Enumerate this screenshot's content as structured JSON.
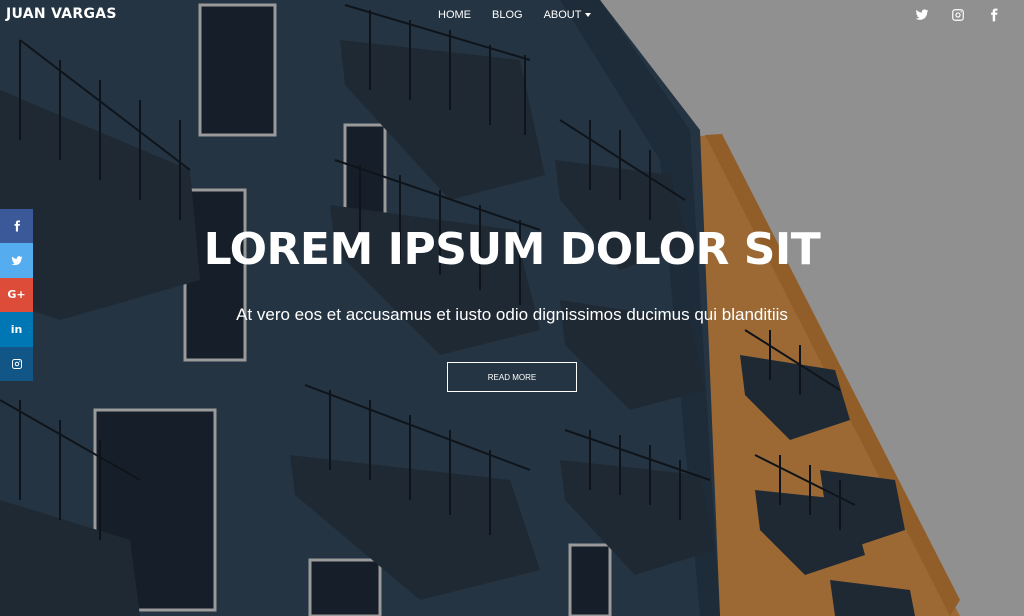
{
  "brand": {
    "name": "JUAN VARGAS"
  },
  "nav": {
    "items": [
      {
        "label": "HOME"
      },
      {
        "label": "BLOG"
      },
      {
        "label": "ABOUT"
      }
    ],
    "social": [
      {
        "icon": "twitter-icon"
      },
      {
        "icon": "instagram-icon"
      },
      {
        "icon": "facebook-icon"
      }
    ]
  },
  "share_bar": {
    "buttons": [
      {
        "icon": "facebook-icon",
        "color": "#3b5998"
      },
      {
        "icon": "twitter-icon",
        "color": "#55acee"
      },
      {
        "icon": "google-plus-icon",
        "label": "G+",
        "color": "#dd4b39"
      },
      {
        "icon": "linkedin-icon",
        "label": "in",
        "color": "#0077b5"
      },
      {
        "icon": "instagram-icon",
        "color": "#125688"
      }
    ]
  },
  "hero": {
    "title": "LOREM IPSUM DOLOR SIT",
    "subtitle": "At vero eos et accusamus et iusto odio dignissimos ducimus qui blanditiis",
    "button_label": "READ MORE"
  }
}
